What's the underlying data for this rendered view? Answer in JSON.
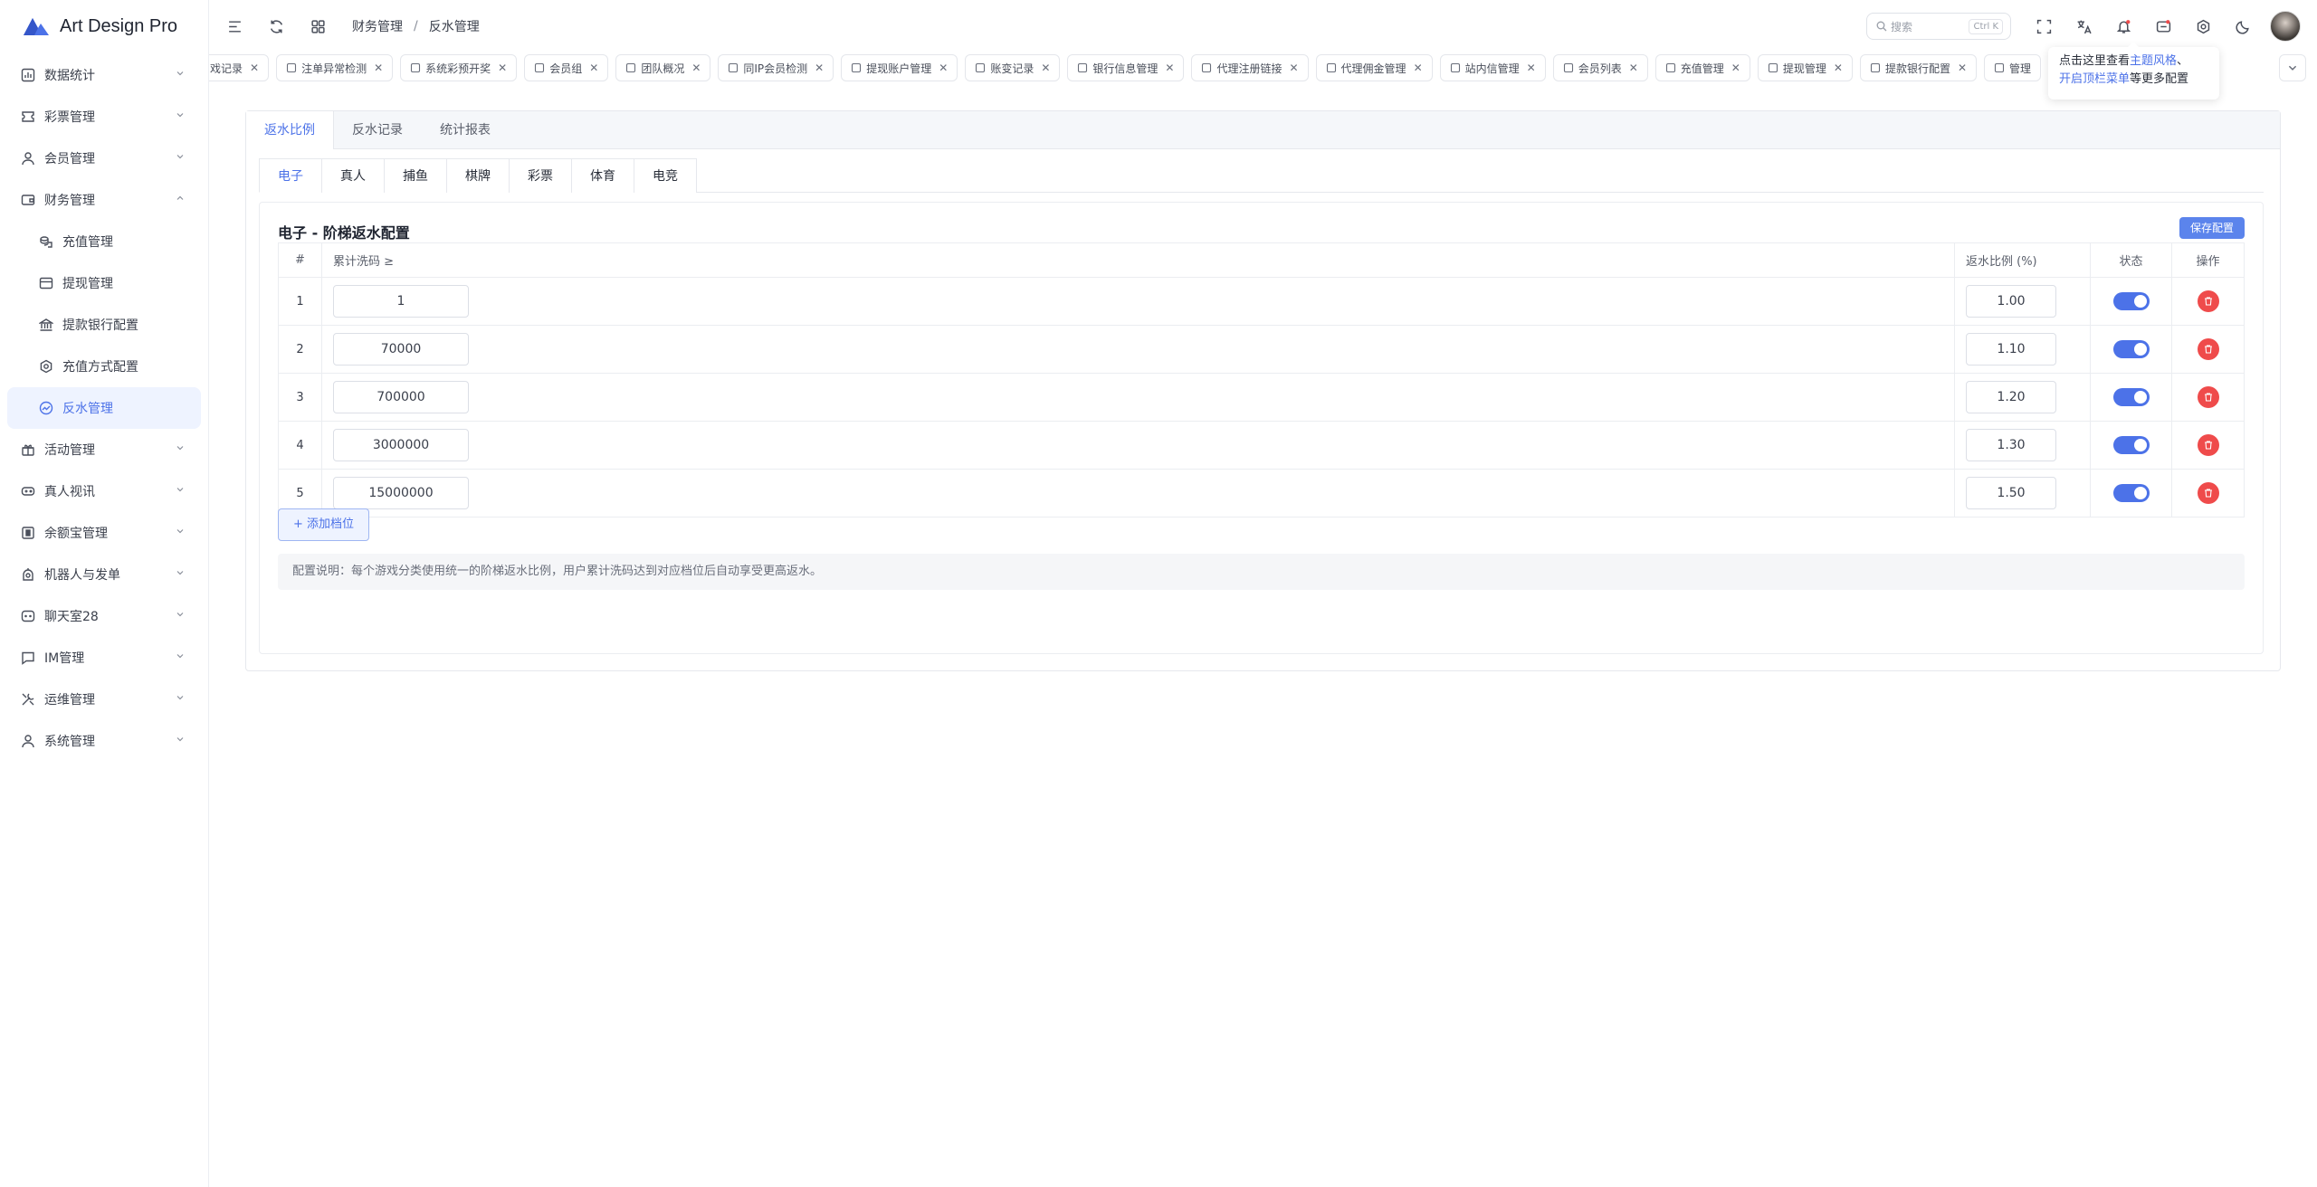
{
  "app": {
    "title": "Art Design Pro",
    "accent": "#4c72e8",
    "danger": "#ef4b4b"
  },
  "sidebar": {
    "items": [
      {
        "label": "数据统计",
        "icon": "chart-icon"
      },
      {
        "label": "彩票管理",
        "icon": "ticket-icon"
      },
      {
        "label": "会员管理",
        "icon": "user-icon"
      },
      {
        "label": "财务管理",
        "icon": "wallet-icon",
        "expanded": true
      }
    ],
    "finance_children": [
      {
        "label": "充值管理",
        "icon": "coins-icon"
      },
      {
        "label": "提现管理",
        "icon": "card-icon"
      },
      {
        "label": "提款银行配置",
        "icon": "bank-icon"
      },
      {
        "label": "充值方式配置",
        "icon": "gear-icon"
      },
      {
        "label": "反水管理",
        "icon": "gauge-icon",
        "active": true
      }
    ],
    "items_after": [
      {
        "label": "活动管理",
        "icon": "gift-icon"
      },
      {
        "label": "真人视讯",
        "icon": "gamepad-icon"
      },
      {
        "label": "余额宝管理",
        "icon": "safe-icon"
      },
      {
        "label": "机器人与发单",
        "icon": "robot-icon"
      },
      {
        "label": "聊天室28",
        "icon": "chat-bubble-icon"
      },
      {
        "label": "IM管理",
        "icon": "message-icon"
      },
      {
        "label": "运维管理",
        "icon": "tools-icon"
      },
      {
        "label": "系统管理",
        "icon": "user-cog-icon"
      }
    ]
  },
  "header": {
    "breadcrumb": [
      "财务管理",
      "反水管理"
    ],
    "search_placeholder": "搜索",
    "search_shortcut": "Ctrl K"
  },
  "tabs": [
    "戏记录",
    "注单异常检测",
    "系统彩预开奖",
    "会员组",
    "团队概况",
    "同IP会员检测",
    "提现账户管理",
    "账变记录",
    "银行信息管理",
    "代理注册链接",
    "代理佣金管理",
    "站内信管理",
    "会员列表",
    "充值管理",
    "提现管理",
    "提款银行配置",
    "管理"
  ],
  "tooltip": {
    "line1_prefix": "点击这里查看",
    "line1_link": "主题风格",
    "line1_suffix": "、",
    "line2_link": "开启顶栏菜单",
    "line2_suffix": "等更多配置"
  },
  "content": {
    "tabs": [
      "返水比例",
      "反水记录",
      "统计报表"
    ],
    "game_tabs": [
      "电子",
      "真人",
      "捕鱼",
      "棋牌",
      "彩票",
      "体育",
      "电竞"
    ],
    "card_title": "电子 - 阶梯返水配置",
    "save_label": "保存配置",
    "columns": [
      "#",
      "累计洗码 ≥",
      "返水比例 (%)",
      "状态",
      "操作"
    ],
    "rows": [
      {
        "idx": "1",
        "threshold": "1",
        "rate": "1.00",
        "enabled": true
      },
      {
        "idx": "2",
        "threshold": "70000",
        "rate": "1.10",
        "enabled": true
      },
      {
        "idx": "3",
        "threshold": "700000",
        "rate": "1.20",
        "enabled": true
      },
      {
        "idx": "4",
        "threshold": "3000000",
        "rate": "1.30",
        "enabled": true
      },
      {
        "idx": "5",
        "threshold": "15000000",
        "rate": "1.50",
        "enabled": true
      }
    ],
    "add_label": "+ 添加档位",
    "note": "配置说明：每个游戏分类使用统一的阶梯返水比例，用户累计洗码达到对应档位后自动享受更高返水。"
  }
}
